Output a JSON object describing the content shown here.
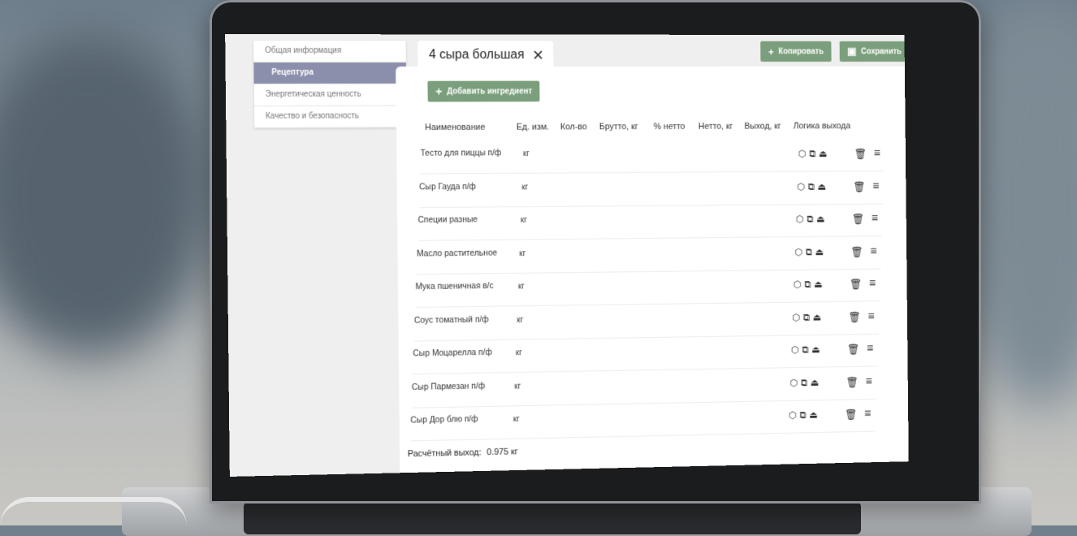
{
  "nav": {
    "items": [
      {
        "label": "Общая информация",
        "active": false
      },
      {
        "label": "Рецептура",
        "active": true
      },
      {
        "label": "Энергетическая ценность",
        "active": false
      },
      {
        "label": "Качество и безопасность",
        "active": false
      }
    ]
  },
  "tab": {
    "title": "4 сыра большая",
    "close_icon": "close-icon"
  },
  "toolbar": {
    "copy_label": "Копировать",
    "save_label": "Сохранить"
  },
  "recipe": {
    "add_label": "Добавить ингредиент",
    "columns": [
      "Наименование",
      "Ед. изм.",
      "Кол-во",
      "Брутто, кг",
      "% нетто",
      "Нетто, кг",
      "Выход, кг",
      "Логика выхода"
    ],
    "rows": [
      {
        "name": "Тесто для пиццы п/ф",
        "unit": "кг"
      },
      {
        "name": "Сыр Гауда п/ф",
        "unit": "кг"
      },
      {
        "name": "Специи разные",
        "unit": "кг"
      },
      {
        "name": "Масло растительное",
        "unit": "кг"
      },
      {
        "name": "Мука пшеничная в/с",
        "unit": "кг"
      },
      {
        "name": "Соус томатный п/ф",
        "unit": "кг"
      },
      {
        "name": "Сыр Моцарелла п/ф",
        "unit": "кг"
      },
      {
        "name": "Сыр Пармезан п/ф",
        "unit": "кг"
      },
      {
        "name": "Сыр Дор блю п/ф",
        "unit": "кг"
      }
    ],
    "logic_icons": [
      "box-icon",
      "package-icon",
      "dish-icon"
    ],
    "yield_label": "Расчётный выход:",
    "yield_value": "0.975 кг"
  },
  "colors": {
    "accent_green": "#7b9f7c",
    "nav_active": "#8c8fac"
  }
}
